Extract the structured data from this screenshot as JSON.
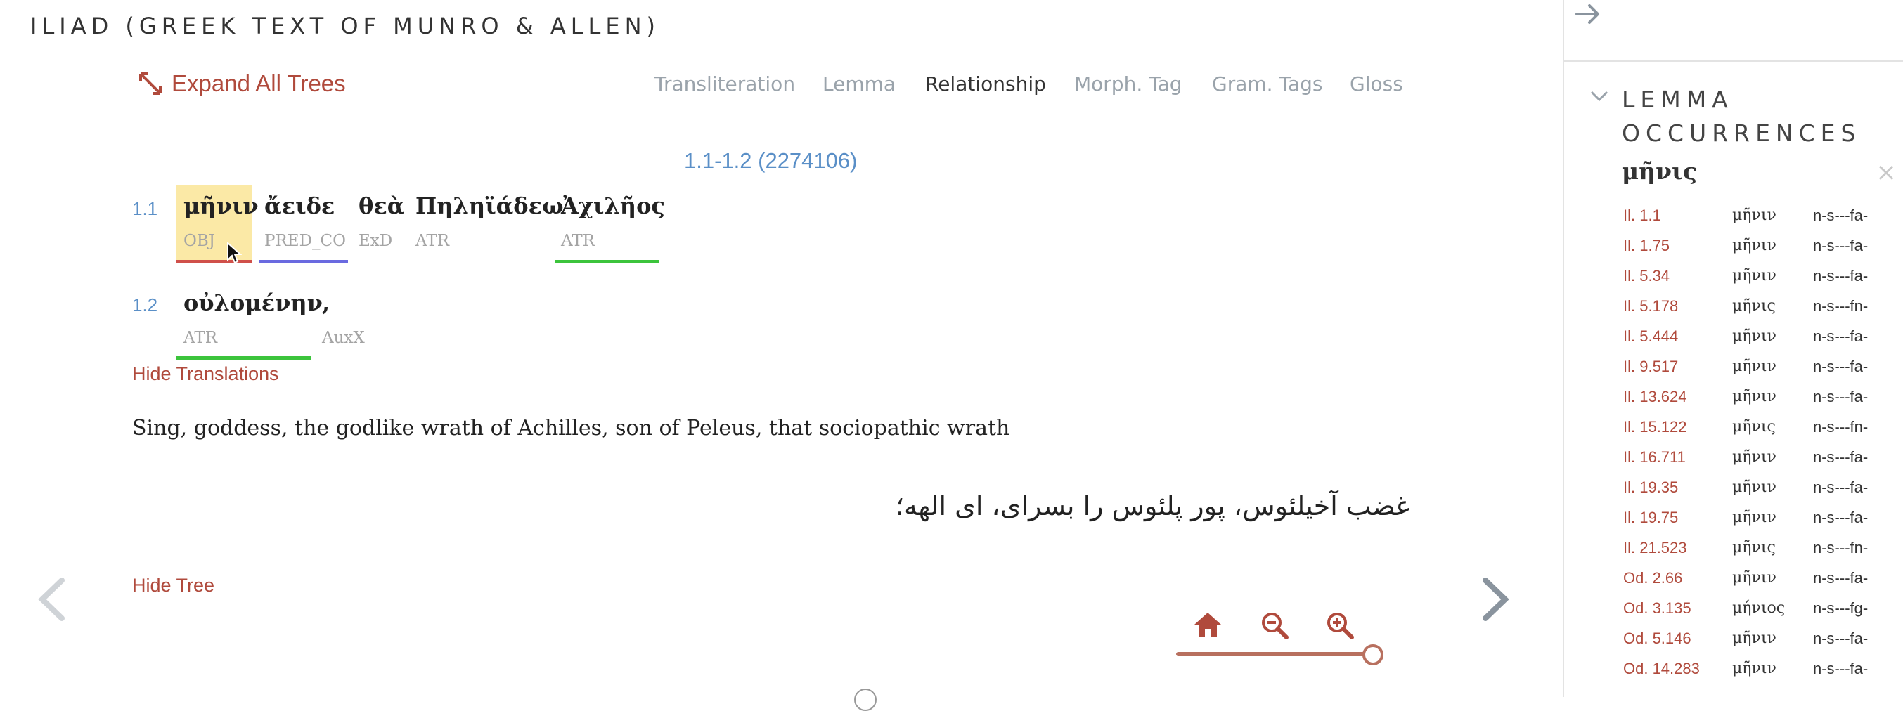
{
  "header": {
    "title": "ILIAD (GREEK TEXT OF MUNRO & ALLEN)"
  },
  "toolbar": {
    "expand_label": "Expand All Trees",
    "tabs": [
      "Transliteration",
      "Lemma",
      "Relationship",
      "Morph. Tag",
      "Gram. Tags",
      "Gloss"
    ],
    "active_tab": "Relationship"
  },
  "passage": {
    "ref": "1.1-1.2 (2274106)"
  },
  "lines": [
    {
      "no": "1.1",
      "words": [
        {
          "form": "μῆνιν",
          "tag": "OBJ"
        },
        {
          "form": "ἄειδε",
          "tag": "PRED_CO"
        },
        {
          "form": "θεὰ",
          "tag": "ExD"
        },
        {
          "form": "Πηληϊάδεω",
          "tag": "ATR"
        },
        {
          "form": "Ἀχιλῆος",
          "tag": "ATR"
        }
      ]
    },
    {
      "no": "1.2",
      "words": [
        {
          "form": "οὐλομένην",
          "tag": "ATR"
        },
        {
          "form": ",",
          "tag": "AuxX"
        }
      ]
    }
  ],
  "links": {
    "hide_translations": "Hide Translations",
    "hide_tree": "Hide Tree"
  },
  "translations": {
    "en": "Sing, goddess, the godlike wrath of Achilles, son of Peleus, that sociopathic wrath",
    "fa": "غضب آخیلئوس، پور پلئوس را بسرای، ای الهه؛"
  },
  "colors": {
    "accent": "#b04a3c",
    "link_blue": "#5a8fc7",
    "highlight": "#fbe9a6",
    "underline_red": "#d0504a",
    "underline_blue": "#6a6ae0",
    "underline_green": "#3cc43c"
  },
  "icons": [
    "expand-icon",
    "arrow-right-icon",
    "chevron-down-icon",
    "close-icon",
    "home-icon",
    "zoom-out-icon",
    "zoom-in-icon",
    "prev-arrow-icon",
    "next-arrow-icon",
    "mouse-cursor-icon"
  ],
  "sidebar": {
    "heading_line1": "LEMMA",
    "heading_line2": "OCCURRENCES",
    "lemma": "μῆνις",
    "close": "×",
    "occurrences": [
      {
        "ref": "Il. 1.1",
        "form": "μῆνιν",
        "tag": "n-s---fa-"
      },
      {
        "ref": "Il. 1.75",
        "form": "μῆνιν",
        "tag": "n-s---fa-"
      },
      {
        "ref": "Il. 5.34",
        "form": "μῆνιν",
        "tag": "n-s---fa-"
      },
      {
        "ref": "Il. 5.178",
        "form": "μῆνις",
        "tag": "n-s---fn-"
      },
      {
        "ref": "Il. 5.444",
        "form": "μῆνιν",
        "tag": "n-s---fa-"
      },
      {
        "ref": "Il. 9.517",
        "form": "μῆνιν",
        "tag": "n-s---fa-"
      },
      {
        "ref": "Il. 13.624",
        "form": "μῆνιν",
        "tag": "n-s---fa-"
      },
      {
        "ref": "Il. 15.122",
        "form": "μῆνις",
        "tag": "n-s---fn-"
      },
      {
        "ref": "Il. 16.711",
        "form": "μῆνιν",
        "tag": "n-s---fa-"
      },
      {
        "ref": "Il. 19.35",
        "form": "μῆνιν",
        "tag": "n-s---fa-"
      },
      {
        "ref": "Il. 19.75",
        "form": "μῆνιν",
        "tag": "n-s---fa-"
      },
      {
        "ref": "Il. 21.523",
        "form": "μῆνις",
        "tag": "n-s---fn-"
      },
      {
        "ref": "Od. 2.66",
        "form": "μῆνιν",
        "tag": "n-s---fa-"
      },
      {
        "ref": "Od. 3.135",
        "form": "μήνιος",
        "tag": "n-s---fg-"
      },
      {
        "ref": "Od. 5.146",
        "form": "μῆνιν",
        "tag": "n-s---fa-"
      },
      {
        "ref": "Od. 14.283",
        "form": "μῆνιν",
        "tag": "n-s---fa-"
      }
    ]
  }
}
